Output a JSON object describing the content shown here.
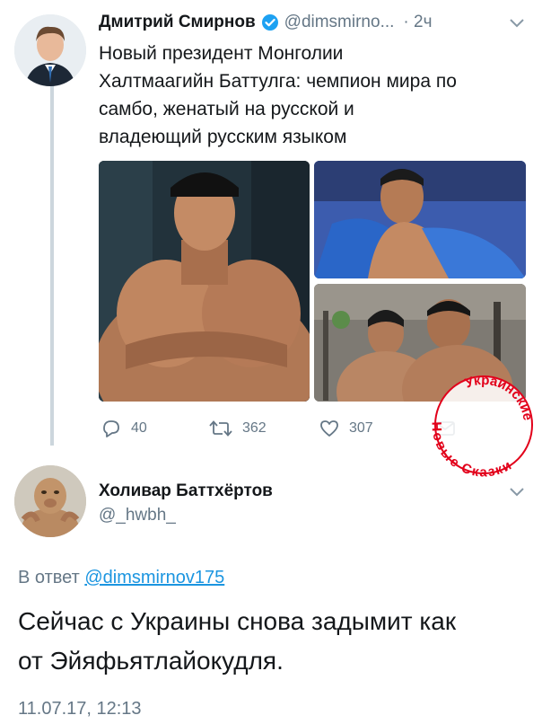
{
  "tweet": {
    "author_name": "Дмитрий Смирнов",
    "author_handle": "@dimsmirno...",
    "time": "· 2ч",
    "text_lines": [
      "Новый президент Монголии",
      "Халтмаагийн Баттулга: чемпион мира по",
      "самбо, женатый на русской и",
      "владеющий русским языком"
    ],
    "actions": {
      "reply_count": "40",
      "retweet_count": "362",
      "like_count": "307"
    }
  },
  "watermark": {
    "text_top": "Украинские",
    "text_bottom": "Новые Сказки"
  },
  "reply": {
    "author_name": "Холивар Баттхёртов",
    "author_handle": "@_hwbh_",
    "in_reply_prefix": "В ответ",
    "in_reply_handle": "@dimsmirnov175",
    "text_lines": [
      "Сейчас с Украины снова задымит как",
      "от Эйяфьятлайокудля."
    ],
    "timestamp": "11.07.17, 12:13"
  },
  "colors": {
    "verified": "#1da1f2",
    "link": "#1b95e0",
    "muted": "#657786",
    "watermark": "#e2001a"
  }
}
